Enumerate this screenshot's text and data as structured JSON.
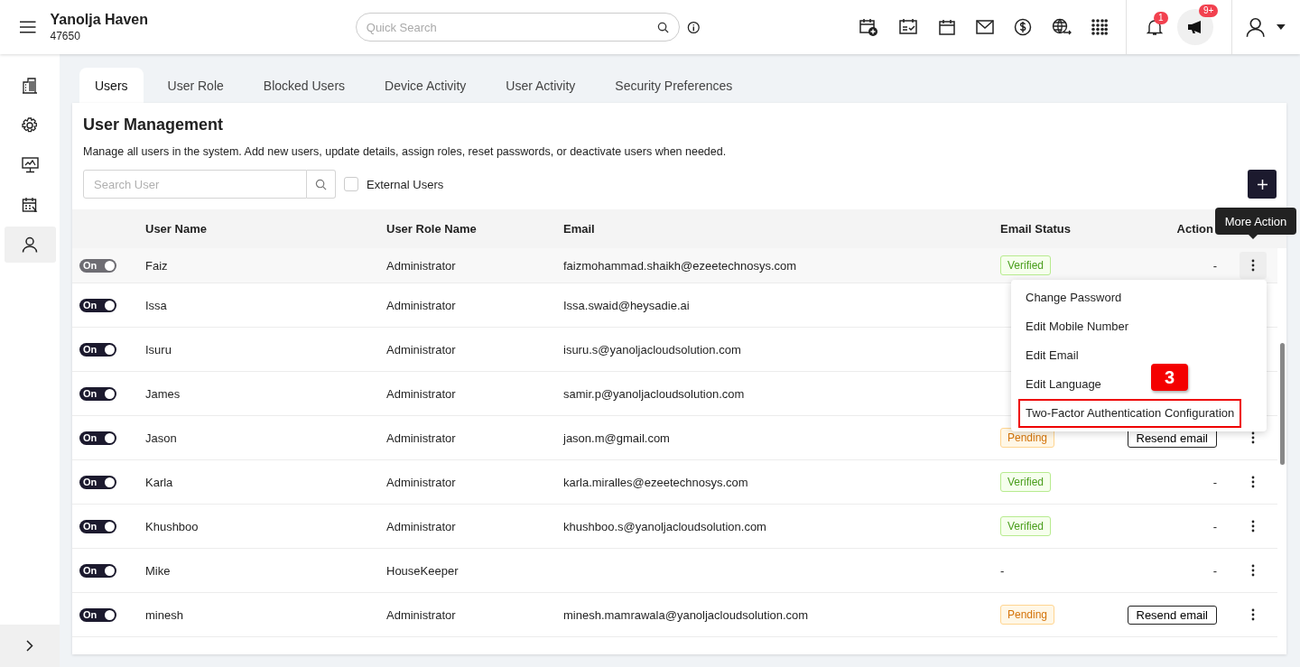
{
  "header": {
    "title": "Yanolja Haven",
    "property_id": "47650",
    "search": {
      "placeholder": "Quick Search"
    },
    "notifications": {
      "badge": "1"
    },
    "announcements": {
      "badge": "9+"
    }
  },
  "sidebar": {
    "items": [
      {
        "selected": false
      },
      {
        "selected": false
      },
      {
        "selected": false
      },
      {
        "selected": false
      },
      {
        "selected": true
      }
    ]
  },
  "tabs": [
    {
      "label": "Users",
      "selected": true
    },
    {
      "label": "User Role",
      "selected": false
    },
    {
      "label": "Blocked Users",
      "selected": false
    },
    {
      "label": "Device Activity",
      "selected": false
    },
    {
      "label": "User Activity",
      "selected": false
    },
    {
      "label": "Security Preferences",
      "selected": false
    }
  ],
  "page": {
    "title": "User Management",
    "description": "Manage all users in the system. Add new users, update details, assign roles, reset passwords, or deactivate users when needed.",
    "search": {
      "placeholder": "Search User"
    },
    "external_users": {
      "label": "External Users",
      "checked": false
    }
  },
  "table": {
    "columns": [
      "User Name",
      "User Role Name",
      "Email",
      "Email Status",
      "Action"
    ],
    "rows": [
      {
        "hovered": true,
        "on": true,
        "toggle": "On",
        "name": "Faiz",
        "role": "Administrator",
        "email": "faizmohammad.shaikh@ezeetechnosys.com",
        "status": {
          "kind": "verified",
          "text": "Verified"
        },
        "action": {
          "kind": "dash",
          "text": "-"
        },
        "more": true
      },
      {
        "hovered": false,
        "on": true,
        "toggle": "On",
        "name": "Issa",
        "role": "Administrator",
        "email": "Issa.swaid@heysadie.ai",
        "more": false
      },
      {
        "hovered": false,
        "on": true,
        "toggle": "On",
        "name": "Isuru",
        "role": "Administrator",
        "email": "isuru.s@yanoljacloudsolution.com",
        "more": false
      },
      {
        "hovered": false,
        "on": true,
        "toggle": "On",
        "name": "James",
        "role": "Administrator",
        "email": "samir.p@yanoljacloudsolution.com",
        "more": false
      },
      {
        "hovered": false,
        "on": true,
        "toggle": "On",
        "name": "Jason",
        "role": "Administrator",
        "email": "jason.m@gmail.com",
        "status": {
          "kind": "pending",
          "text": "Pending"
        },
        "action": {
          "kind": "resend",
          "text": "Resend email"
        },
        "more": true
      },
      {
        "hovered": false,
        "on": true,
        "toggle": "On",
        "name": "Karla",
        "role": "Administrator",
        "email": "karla.miralles@ezeetechnosys.com",
        "status": {
          "kind": "verified",
          "text": "Verified"
        },
        "action": {
          "kind": "dash",
          "text": "-"
        },
        "more": true
      },
      {
        "hovered": false,
        "on": true,
        "toggle": "On",
        "name": "Khushboo",
        "role": "Administrator",
        "email": "khushboo.s@yanoljacloudsolution.com",
        "status": {
          "kind": "verified",
          "text": "Verified"
        },
        "action": {
          "kind": "dash",
          "text": "-"
        },
        "more": true
      },
      {
        "hovered": false,
        "on": true,
        "toggle": "On",
        "name": "Mike",
        "role": "HouseKeeper",
        "status": {
          "kind": "none",
          "text": "-"
        },
        "action": {
          "kind": "dash",
          "text": "-"
        },
        "more": true
      },
      {
        "hovered": false,
        "on": true,
        "toggle": "On",
        "name": "minesh",
        "role": "Administrator",
        "email": "minesh.mamrawala@yanoljacloudsolution.com",
        "status": {
          "kind": "pending",
          "text": "Pending"
        },
        "action": {
          "kind": "resend",
          "text": "Resend email"
        },
        "more": true
      }
    ]
  },
  "tooltip": "More Action",
  "menu": {
    "items": [
      {
        "label": "Change Password",
        "highlighted": false
      },
      {
        "label": "Edit Mobile Number",
        "highlighted": false
      },
      {
        "label": "Edit Email",
        "highlighted": false
      },
      {
        "label": "Edit Language",
        "highlighted": false
      },
      {
        "label": "Two-Factor Authentication Configuration",
        "highlighted": true
      }
    ],
    "callout": "3"
  }
}
